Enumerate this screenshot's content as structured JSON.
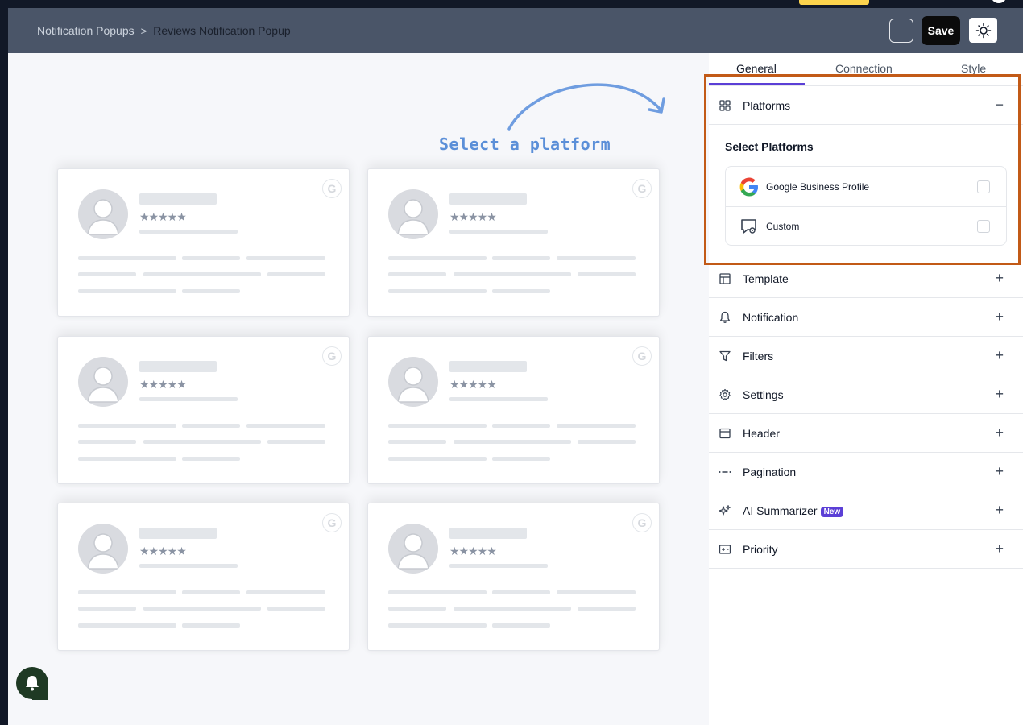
{
  "breadcrumb": {
    "parent": "Notification Popups",
    "separator": ">",
    "current": "Reviews Notification Popup"
  },
  "toolbar": {
    "save_label": "Save",
    "theme_icon": "sun-icon"
  },
  "canvas": {
    "hint_text": "Select a platform",
    "review_card_count": 6,
    "stars_glyph": "★★★★★",
    "badge_letter": "G"
  },
  "sidebar": {
    "tabs": [
      {
        "label": "General",
        "active": true
      },
      {
        "label": "Connection",
        "active": false
      },
      {
        "label": "Style",
        "active": false
      }
    ],
    "platforms": {
      "title": "Platforms",
      "expanded": true,
      "toggle": "−",
      "subtitle": "Select Platforms",
      "options": [
        {
          "label": "Google Business Profile",
          "icon": "google-logo-icon",
          "checked": false
        },
        {
          "label": "Custom",
          "icon": "custom-chat-icon",
          "checked": false
        }
      ]
    },
    "sections": [
      {
        "label": "Template",
        "icon": "template-icon",
        "toggle": "+"
      },
      {
        "label": "Notification",
        "icon": "bell-icon",
        "toggle": "+"
      },
      {
        "label": "Filters",
        "icon": "filter-icon",
        "toggle": "+"
      },
      {
        "label": "Settings",
        "icon": "gear-icon",
        "toggle": "+"
      },
      {
        "label": "Header",
        "icon": "header-icon",
        "toggle": "+"
      },
      {
        "label": "Pagination",
        "icon": "pagination-icon",
        "toggle": "+"
      },
      {
        "label": "AI Summarizer",
        "icon": "sparkle-icon",
        "toggle": "+",
        "badge": "New"
      },
      {
        "label": "Priority",
        "icon": "priority-icon",
        "toggle": "+"
      }
    ]
  },
  "colors": {
    "topbar": "#4a5568",
    "accent": "#5b3fd6",
    "highlight": "#c25a17",
    "hint": "#5b8fd8"
  }
}
